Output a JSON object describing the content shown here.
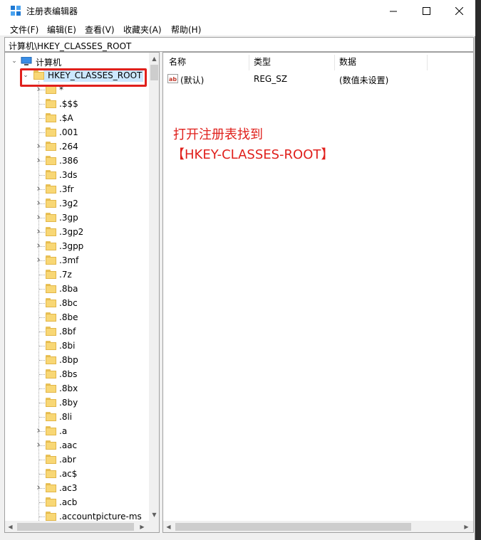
{
  "window": {
    "title": "注册表编辑器",
    "controls": {
      "minimize": "—",
      "maximize": "☐",
      "close": "✕"
    }
  },
  "menu": [
    "文件(F)",
    "编辑(E)",
    "查看(V)",
    "收藏夹(A)",
    "帮助(H)"
  ],
  "address": "计算机\\HKEY_CLASSES_ROOT",
  "tree": {
    "root_label": "计算机",
    "selected_label": "HKEY_CLASSES_ROOT",
    "children": [
      {
        "label": "*",
        "expandable": true
      },
      {
        "label": ".$$$",
        "expandable": false
      },
      {
        "label": ".$A",
        "expandable": false
      },
      {
        "label": ".001",
        "expandable": false
      },
      {
        "label": ".264",
        "expandable": true
      },
      {
        "label": ".386",
        "expandable": true
      },
      {
        "label": ".3ds",
        "expandable": false
      },
      {
        "label": ".3fr",
        "expandable": true
      },
      {
        "label": ".3g2",
        "expandable": true
      },
      {
        "label": ".3gp",
        "expandable": true
      },
      {
        "label": ".3gp2",
        "expandable": true
      },
      {
        "label": ".3gpp",
        "expandable": true
      },
      {
        "label": ".3mf",
        "expandable": true
      },
      {
        "label": ".7z",
        "expandable": false
      },
      {
        "label": ".8ba",
        "expandable": false
      },
      {
        "label": ".8bc",
        "expandable": false
      },
      {
        "label": ".8be",
        "expandable": false
      },
      {
        "label": ".8bf",
        "expandable": false
      },
      {
        "label": ".8bi",
        "expandable": false
      },
      {
        "label": ".8bp",
        "expandable": false
      },
      {
        "label": ".8bs",
        "expandable": false
      },
      {
        "label": ".8bx",
        "expandable": false
      },
      {
        "label": ".8by",
        "expandable": false
      },
      {
        "label": ".8li",
        "expandable": false
      },
      {
        "label": ".a",
        "expandable": true
      },
      {
        "label": ".aac",
        "expandable": true
      },
      {
        "label": ".abr",
        "expandable": false
      },
      {
        "label": ".ac$",
        "expandable": false
      },
      {
        "label": ".ac3",
        "expandable": true
      },
      {
        "label": ".acb",
        "expandable": false
      },
      {
        "label": ".accountpicture-ms",
        "expandable": false
      }
    ]
  },
  "list": {
    "headers": {
      "name": "名称",
      "type": "类型",
      "data": "数据"
    },
    "rows": [
      {
        "name": "(默认)",
        "type": "REG_SZ",
        "data": "(数值未设置)"
      }
    ]
  },
  "annotation": {
    "line1": "打开注册表找到",
    "line2": "【HKEY-CLASSES-ROOT】",
    "color": "#e0201c"
  },
  "colors": {
    "selection": "#cce8ff",
    "highlight_box": "#e0201c",
    "folder": "#f8d775"
  }
}
